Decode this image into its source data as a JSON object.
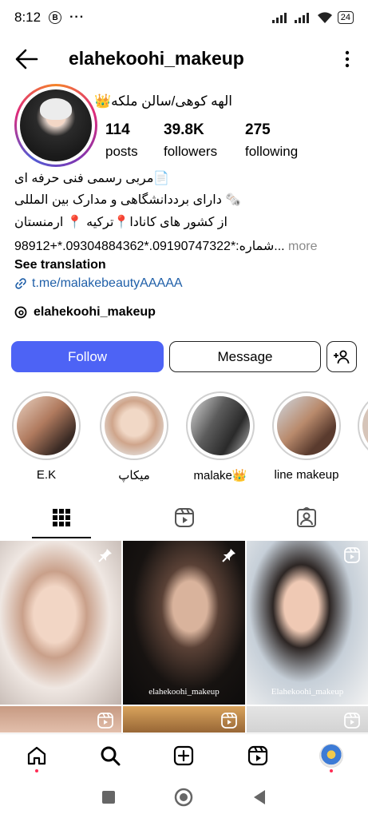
{
  "status_bar": {
    "time": "8:12",
    "b_badge": "B",
    "more_dots": "···",
    "battery": "24"
  },
  "header": {
    "username": "elahekoohi_makeup"
  },
  "profile": {
    "full_name": "الهه کوهی/سالن ملکه👑",
    "stats": [
      {
        "value": "114",
        "label": "posts"
      },
      {
        "value": "39.8K",
        "label": "followers"
      },
      {
        "value": "275",
        "label": "following"
      }
    ],
    "bio": [
      "📄مربی رسمی فنی حرفه ای",
      "🗞️ دارای برددانشگاهی و مدارک بین المللی",
      "از کشور های کانادا📍ترکیه 📍 ارمنستان",
      "98912+*.09304884362*.09190747322*:شماره..."
    ],
    "bio_more": " more",
    "see_translation": "See translation",
    "link": "t.me/malakebeautyAAAAA",
    "threads_handle": "elahekoohi_makeup"
  },
  "actions": {
    "follow": "Follow",
    "message": "Message"
  },
  "highlights": [
    {
      "label": "E.K"
    },
    {
      "label": "میکاپ"
    },
    {
      "label": "malake👑"
    },
    {
      "label": "line makeup"
    },
    {
      "label": ""
    }
  ],
  "posts": [
    {
      "caption": "",
      "badge": "pin"
    },
    {
      "caption": "elahekoohi_makeup",
      "badge": "pin"
    },
    {
      "caption": "Elahekoohi_makeup",
      "badge": "reel"
    },
    {
      "caption": "",
      "badge": "reel"
    },
    {
      "caption": "",
      "badge": "reel"
    },
    {
      "caption": "",
      "badge": "reel"
    }
  ],
  "colors": {
    "follow_button": "#4d63f5",
    "link": "#1f5fa8",
    "notification_dot": "#ff2d55"
  }
}
